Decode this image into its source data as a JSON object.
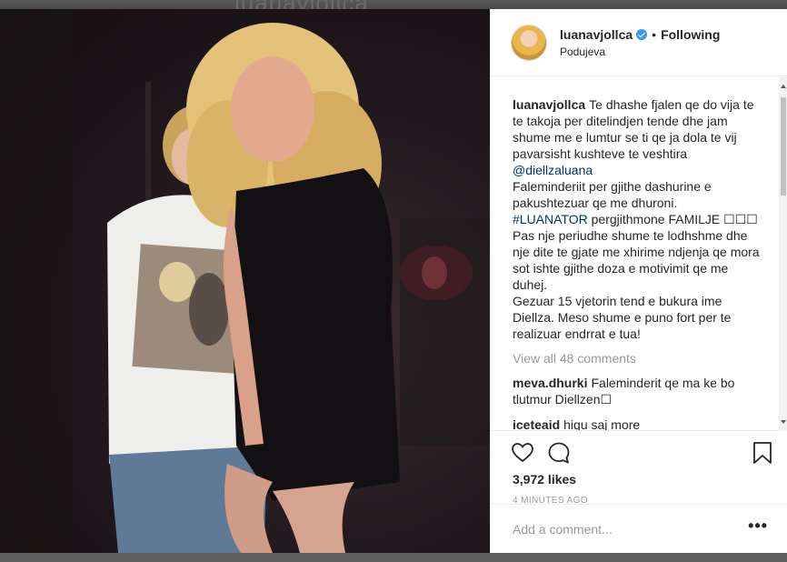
{
  "backdrop": {
    "title": "luanavjollca"
  },
  "post": {
    "username": "luanavjollca",
    "separator": "•",
    "follow_status": "Following",
    "location": "Podujeva",
    "caption_lines": [
      "Te dhashe fjalen qe do vija te te takoja per ditelindjen tende dhe jam shume me e lumtur se ti qe ja dola te vij pavarsisht kushteve te veshtira",
      "@diellzaluana",
      "Faleminderiit per gjithe dashurine e pakushtezuar qe me dhuroni.",
      "#LUANATOR",
      "pergjithmone FAMILJE ☐☐☐",
      "Pas nje periudhe shume te lodhshme dhe nje dite te gjate me xhirime ndjenja qe mora sot ishte gjithe doza e motivimit qe me duhej.",
      "Gezuar 15 vjetorin tend e bukura ime Diellza. Meso shume e puno fort per te realizuar endrrat e tua!"
    ],
    "view_all_comments": "View all 48 comments",
    "comments": [
      {
        "username": "meva.dhurki",
        "text": "Faleminderit qe ma ke bo tlutmur Diellzen☐"
      },
      {
        "username": "iceteaid",
        "text": "hiqu saj more"
      }
    ],
    "likes": "3,972 likes",
    "time": "4 MINUTES AGO",
    "add_comment_placeholder": "Add a comment...",
    "more_label": "•••"
  },
  "colors": {
    "verified_badge": "#3897f0",
    "link": "#003569",
    "muted_text": "#999999",
    "primary_text": "#262626"
  },
  "icons": {
    "like": "heart-icon",
    "comment": "comment-icon",
    "save": "bookmark-icon",
    "verified": "verified-badge-icon"
  }
}
